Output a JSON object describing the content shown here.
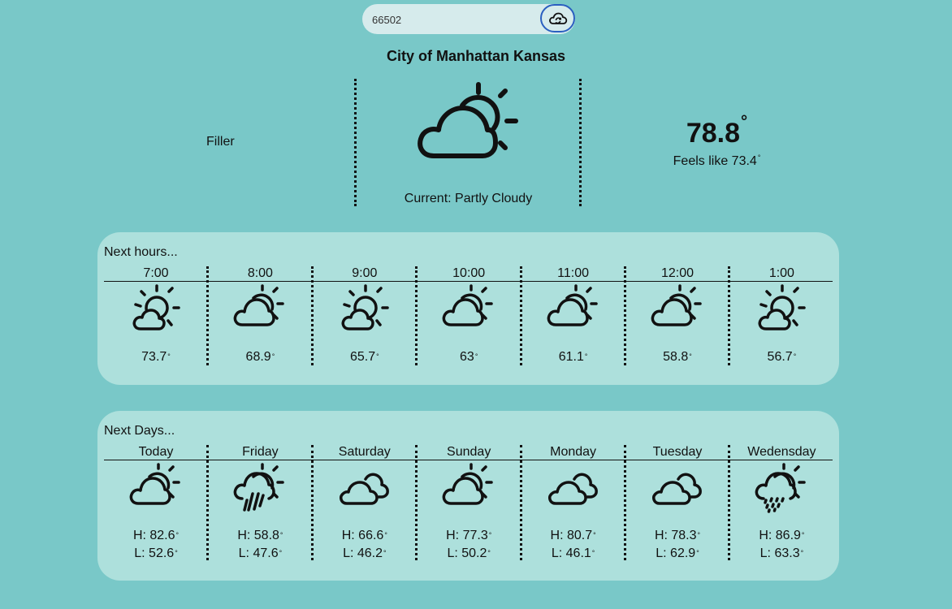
{
  "search": {
    "value": "66502",
    "button_icon": "cloud-refresh-icon"
  },
  "location": {
    "title": "City of Manhattan Kansas"
  },
  "current": {
    "filler": "Filler",
    "icon": "partly-cloudy-icon",
    "condition": "Current: Partly Cloudy",
    "temp": "78.8",
    "feels_like": "Feels like 73.4"
  },
  "hours": {
    "title": "Next hours...",
    "items": [
      {
        "time": "7:00",
        "temp": "73.7",
        "icon": "sun-behind-cloud-icon"
      },
      {
        "time": "8:00",
        "temp": "68.9",
        "icon": "cloud-sun-icon"
      },
      {
        "time": "9:00",
        "temp": "65.7",
        "icon": "sun-behind-cloud-icon"
      },
      {
        "time": "10:00",
        "temp": "63",
        "icon": "cloud-sun-icon"
      },
      {
        "time": "11:00",
        "temp": "61.1",
        "icon": "cloud-sun-icon"
      },
      {
        "time": "12:00",
        "temp": "58.8",
        "icon": "cloud-sun-icon"
      },
      {
        "time": "1:00",
        "temp": "56.7",
        "icon": "sun-behind-cloud-icon"
      }
    ]
  },
  "days": {
    "title": "Next Days...",
    "items": [
      {
        "day": "Today",
        "high": "H: 82.6",
        "low": "L: 52.6",
        "icon": "cloud-sun-icon"
      },
      {
        "day": "Friday",
        "high": "H: 58.8",
        "low": "L: 47.6",
        "icon": "rain-sun-icon"
      },
      {
        "day": "Saturday",
        "high": "H: 66.6",
        "low": "L: 46.2",
        "icon": "clouds-icon"
      },
      {
        "day": "Sunday",
        "high": "H: 77.3",
        "low": "L: 50.2",
        "icon": "cloud-sun-icon"
      },
      {
        "day": "Monday",
        "high": "H: 80.7",
        "low": "L: 46.1",
        "icon": "clouds-icon"
      },
      {
        "day": "Tuesday",
        "high": "H: 78.3",
        "low": "L: 62.9",
        "icon": "clouds-icon"
      },
      {
        "day": "Wedensday",
        "high": "H: 86.9",
        "low": "L: 63.3",
        "icon": "sleet-sun-icon"
      }
    ]
  },
  "colors": {
    "background": "#79c8c8",
    "panel": "#ade0dc",
    "search_bg": "#d6ebec",
    "button_border": "#2a5fc0"
  }
}
